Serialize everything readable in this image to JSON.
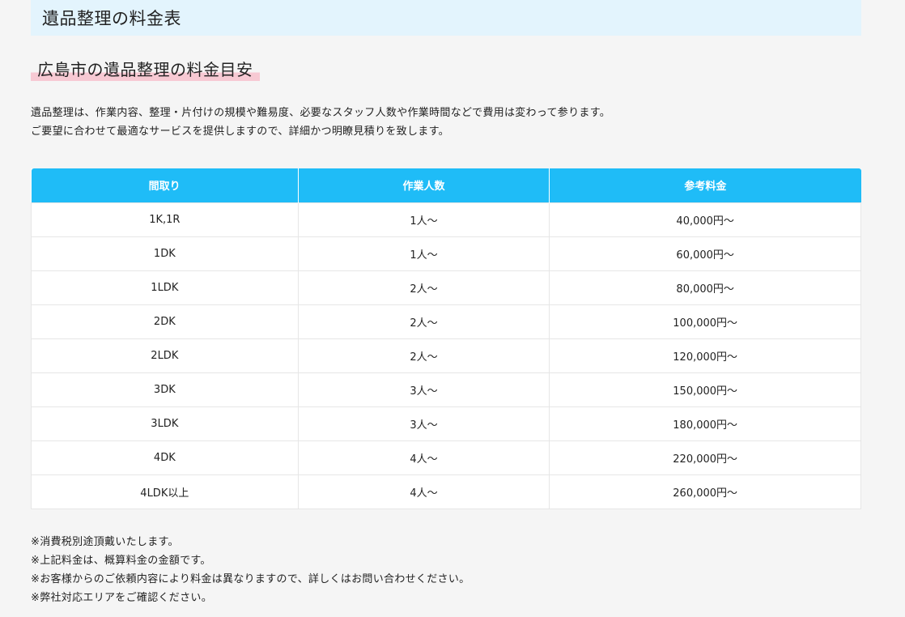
{
  "section_title": "遺品整理の料金表",
  "sub_heading": "広島市の遺品整理の料金目安",
  "intro": [
    "遺品整理は、作業内容、整理・片付けの規模や難易度、必要なスタッフ人数や作業時間などで費用は変わって参ります。",
    "ご要望に合わせて最適なサービスを提供しますので、詳細かつ明瞭見積りを致します。"
  ],
  "table": {
    "headers": [
      "間取り",
      "作業人数",
      "参考料金"
    ],
    "rows": [
      [
        "1K,1R",
        "1人～",
        "40,000円～"
      ],
      [
        "1DK",
        "1人～",
        "60,000円～"
      ],
      [
        "1LDK",
        "2人～",
        "80,000円～"
      ],
      [
        "2DK",
        "2人～",
        "100,000円～"
      ],
      [
        "2LDK",
        "2人～",
        "120,000円～"
      ],
      [
        "3DK",
        "3人～",
        "150,000円～"
      ],
      [
        "3LDK",
        "3人～",
        "180,000円～"
      ],
      [
        "4DK",
        "4人～",
        "220,000円～"
      ],
      [
        "4LDK以上",
        "4人～",
        "260,000円～"
      ]
    ]
  },
  "notes": [
    "※消費税別途頂戴いたします。",
    "※上記料金は、概算料金の金額です。",
    "※お客様からのご依頼内容により料金は異なりますので、詳しくはお問い合わせください。",
    "※弊社対応エリアをご確認ください。"
  ],
  "colors": {
    "header_bg": "#e3f4fd",
    "table_header": "#1fbcf7",
    "underline_highlight": "#f7c9d3"
  }
}
